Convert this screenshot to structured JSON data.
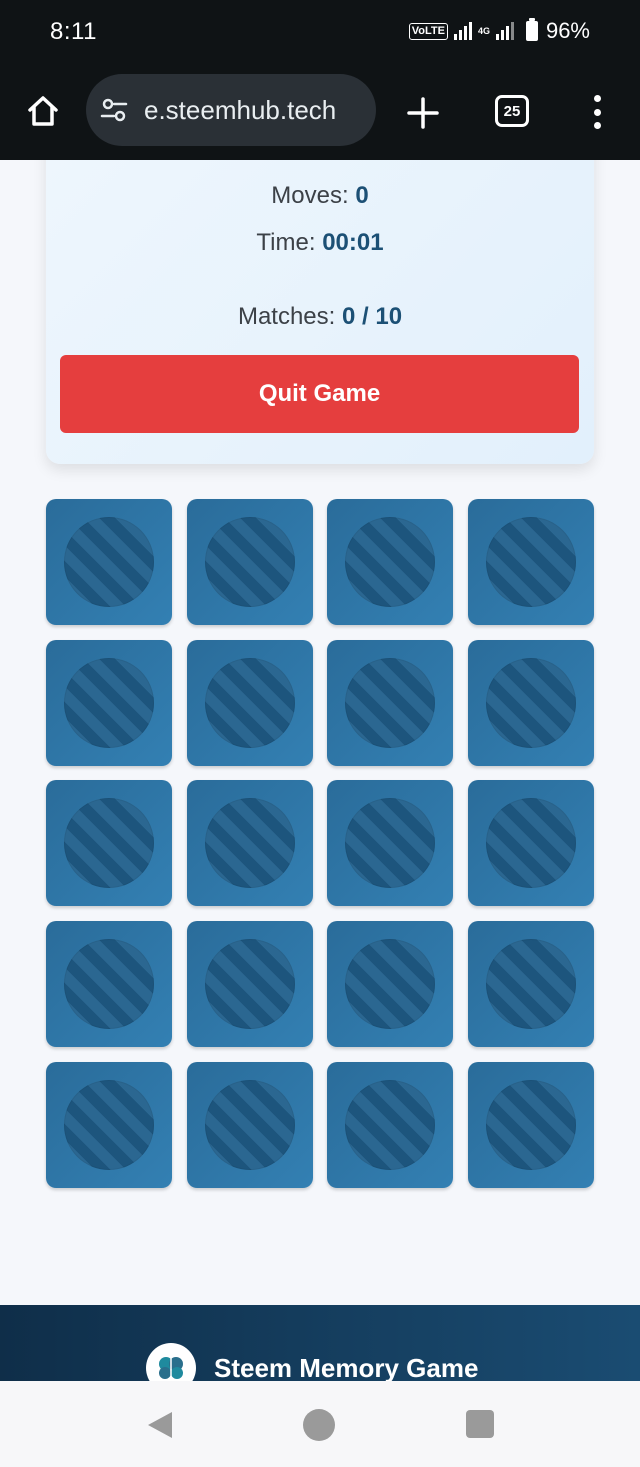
{
  "status_bar": {
    "time": "8:11",
    "volte": "VoLTE",
    "lte": "4G",
    "battery": "96%"
  },
  "browser": {
    "url": "e.steemhub.tech",
    "tab_count": "25",
    "icons": {
      "home": "home-icon",
      "site_settings": "tune-icon",
      "new_tab": "plus-icon",
      "tabs": "tab-switcher-icon",
      "menu": "more-vert-icon"
    }
  },
  "stats": {
    "moves_label": "Moves:",
    "moves_value": "0",
    "time_label": "Time:",
    "time_value": "00:01",
    "matches_label": "Matches:",
    "matches_value": "0 / 10",
    "quit_label": "Quit Game"
  },
  "board": {
    "columns": 4,
    "rows": 5,
    "card_count": 20,
    "face_down": true
  },
  "footer": {
    "title": "Steem Memory Game",
    "logo": "brain-icon"
  },
  "colors": {
    "quit_button": "#e53e3e",
    "stat_value": "#1c5075",
    "card_back": "#2f78a9",
    "footer": "#143d5e"
  }
}
